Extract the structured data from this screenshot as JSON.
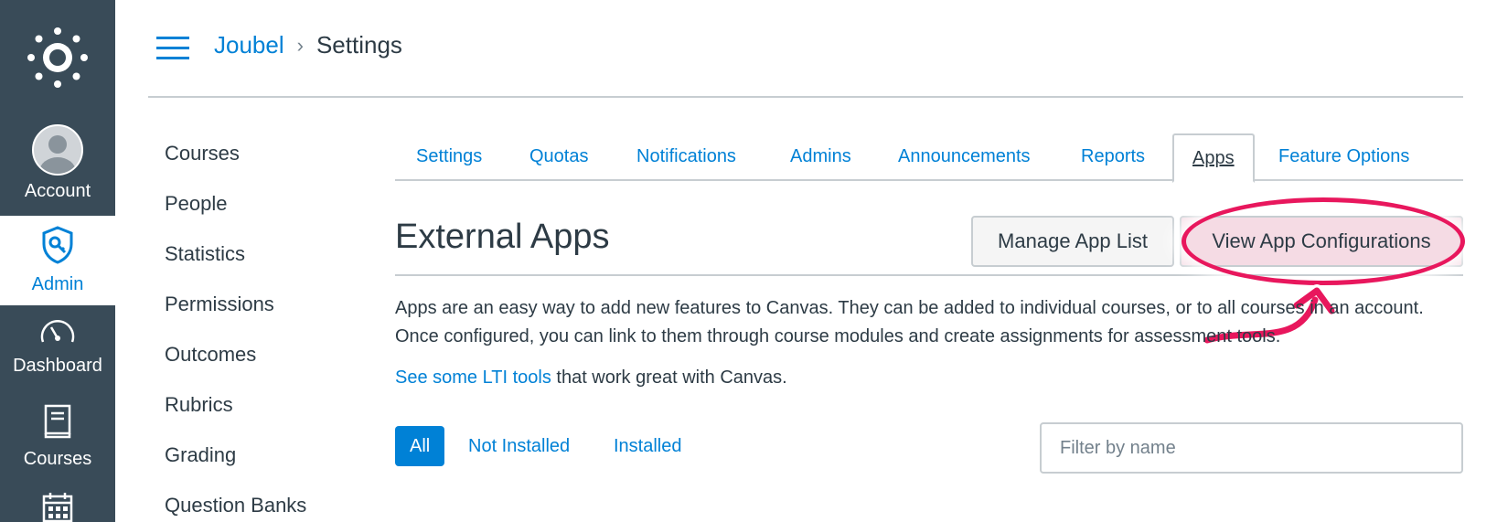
{
  "global_nav": {
    "account_label": "Account",
    "admin_label": "Admin",
    "dashboard_label": "Dashboard",
    "courses_label": "Courses"
  },
  "header": {
    "breadcrumb_root": "Joubel",
    "breadcrumb_separator": "›",
    "breadcrumb_current": "Settings"
  },
  "subnav": {
    "items": [
      {
        "label": "Courses"
      },
      {
        "label": "People"
      },
      {
        "label": "Statistics"
      },
      {
        "label": "Permissions"
      },
      {
        "label": "Outcomes"
      },
      {
        "label": "Rubrics"
      },
      {
        "label": "Grading"
      },
      {
        "label": "Question Banks"
      }
    ]
  },
  "tabs": [
    {
      "label": "Settings"
    },
    {
      "label": "Quotas"
    },
    {
      "label": "Notifications"
    },
    {
      "label": "Admins"
    },
    {
      "label": "Announcements"
    },
    {
      "label": "Reports"
    },
    {
      "label": "Apps",
      "active": true
    },
    {
      "label": "Feature Options"
    }
  ],
  "external_apps": {
    "title": "External Apps",
    "manage_button": "Manage App List",
    "view_button": "View App Configurations",
    "description": "Apps are an easy way to add new features to Canvas. They can be added to individual courses, or to all courses in an account. Once configured, you can link to them through course modules and create assignments for assessment tools.",
    "lti_link": "See some LTI tools",
    "lti_suffix": " that work great with Canvas."
  },
  "filters": {
    "all": "All",
    "not_installed": "Not Installed",
    "installed": "Installed",
    "search_placeholder": "Filter by name"
  },
  "colors": {
    "nav_bg": "#394b58",
    "link_blue": "#0081d6",
    "annotation_pink": "#e8175d"
  }
}
